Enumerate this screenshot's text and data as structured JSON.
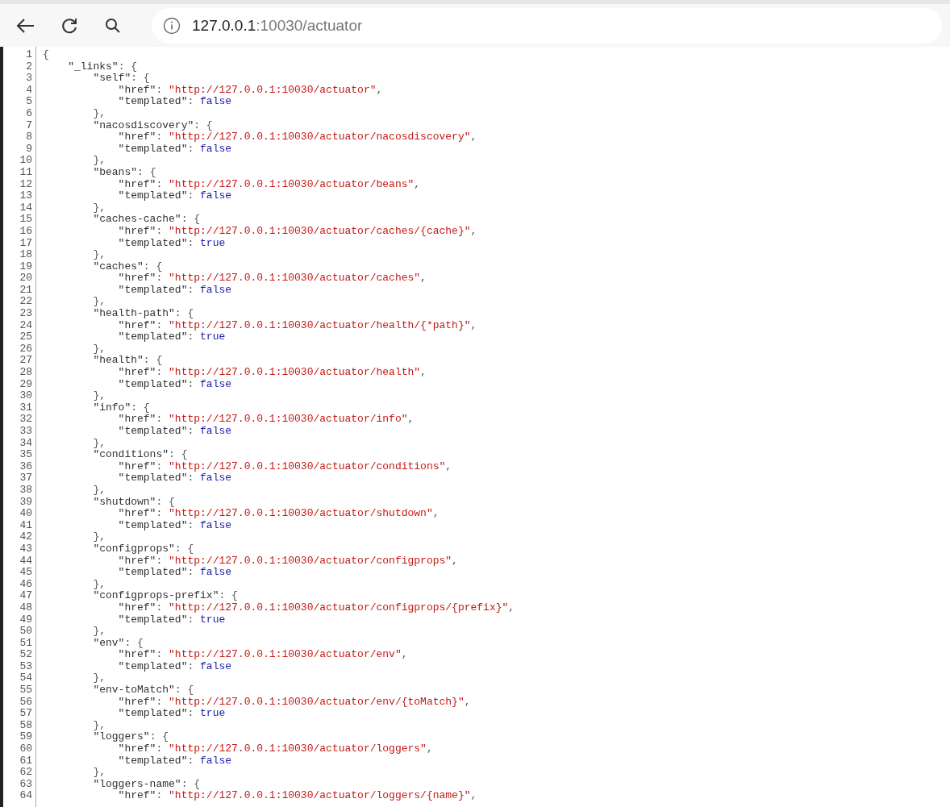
{
  "toolbar": {
    "address": {
      "host": "127.0.0.1",
      "rest": ":10030/actuator"
    }
  },
  "lines": [
    {
      "number": "1",
      "tokens": [
        {
          "kind": "punct",
          "text": "{"
        }
      ]
    },
    {
      "number": "2",
      "tokens": [
        {
          "kind": "key",
          "text": "    \"_links\""
        },
        {
          "kind": "punct",
          "text": ": {"
        }
      ]
    },
    {
      "number": "3",
      "tokens": [
        {
          "kind": "key",
          "text": "        \"self\""
        },
        {
          "kind": "punct",
          "text": ": {"
        }
      ]
    },
    {
      "number": "4",
      "tokens": [
        {
          "kind": "key",
          "text": "            \"href\""
        },
        {
          "kind": "punct",
          "text": ": "
        },
        {
          "kind": "string",
          "text": "\"http://127.0.0.1:10030/actuator\""
        },
        {
          "kind": "punct",
          "text": ","
        }
      ]
    },
    {
      "number": "5",
      "tokens": [
        {
          "kind": "key",
          "text": "            \"templated\""
        },
        {
          "kind": "punct",
          "text": ": "
        },
        {
          "kind": "bool",
          "text": "false"
        }
      ]
    },
    {
      "number": "6",
      "tokens": [
        {
          "kind": "punct",
          "text": "        },"
        }
      ]
    },
    {
      "number": "7",
      "tokens": [
        {
          "kind": "key",
          "text": "        \"nacosdiscovery\""
        },
        {
          "kind": "punct",
          "text": ": {"
        }
      ]
    },
    {
      "number": "8",
      "tokens": [
        {
          "kind": "key",
          "text": "            \"href\""
        },
        {
          "kind": "punct",
          "text": ": "
        },
        {
          "kind": "string",
          "text": "\"http://127.0.0.1:10030/actuator/nacosdiscovery\""
        },
        {
          "kind": "punct",
          "text": ","
        }
      ]
    },
    {
      "number": "9",
      "tokens": [
        {
          "kind": "key",
          "text": "            \"templated\""
        },
        {
          "kind": "punct",
          "text": ": "
        },
        {
          "kind": "bool",
          "text": "false"
        }
      ]
    },
    {
      "number": "10",
      "tokens": [
        {
          "kind": "punct",
          "text": "        },"
        }
      ]
    },
    {
      "number": "11",
      "tokens": [
        {
          "kind": "key",
          "text": "        \"beans\""
        },
        {
          "kind": "punct",
          "text": ": {"
        }
      ]
    },
    {
      "number": "12",
      "tokens": [
        {
          "kind": "key",
          "text": "            \"href\""
        },
        {
          "kind": "punct",
          "text": ": "
        },
        {
          "kind": "string",
          "text": "\"http://127.0.0.1:10030/actuator/beans\""
        },
        {
          "kind": "punct",
          "text": ","
        }
      ]
    },
    {
      "number": "13",
      "tokens": [
        {
          "kind": "key",
          "text": "            \"templated\""
        },
        {
          "kind": "punct",
          "text": ": "
        },
        {
          "kind": "bool",
          "text": "false"
        }
      ]
    },
    {
      "number": "14",
      "tokens": [
        {
          "kind": "punct",
          "text": "        },"
        }
      ]
    },
    {
      "number": "15",
      "tokens": [
        {
          "kind": "key",
          "text": "        \"caches-cache\""
        },
        {
          "kind": "punct",
          "text": ": {"
        }
      ]
    },
    {
      "number": "16",
      "tokens": [
        {
          "kind": "key",
          "text": "            \"href\""
        },
        {
          "kind": "punct",
          "text": ": "
        },
        {
          "kind": "string",
          "text": "\"http://127.0.0.1:10030/actuator/caches/{cache}\""
        },
        {
          "kind": "punct",
          "text": ","
        }
      ]
    },
    {
      "number": "17",
      "tokens": [
        {
          "kind": "key",
          "text": "            \"templated\""
        },
        {
          "kind": "punct",
          "text": ": "
        },
        {
          "kind": "bool",
          "text": "true"
        }
      ]
    },
    {
      "number": "18",
      "tokens": [
        {
          "kind": "punct",
          "text": "        },"
        }
      ]
    },
    {
      "number": "19",
      "tokens": [
        {
          "kind": "key",
          "text": "        \"caches\""
        },
        {
          "kind": "punct",
          "text": ": {"
        }
      ]
    },
    {
      "number": "20",
      "tokens": [
        {
          "kind": "key",
          "text": "            \"href\""
        },
        {
          "kind": "punct",
          "text": ": "
        },
        {
          "kind": "string",
          "text": "\"http://127.0.0.1:10030/actuator/caches\""
        },
        {
          "kind": "punct",
          "text": ","
        }
      ]
    },
    {
      "number": "21",
      "tokens": [
        {
          "kind": "key",
          "text": "            \"templated\""
        },
        {
          "kind": "punct",
          "text": ": "
        },
        {
          "kind": "bool",
          "text": "false"
        }
      ]
    },
    {
      "number": "22",
      "tokens": [
        {
          "kind": "punct",
          "text": "        },"
        }
      ]
    },
    {
      "number": "23",
      "tokens": [
        {
          "kind": "key",
          "text": "        \"health-path\""
        },
        {
          "kind": "punct",
          "text": ": {"
        }
      ]
    },
    {
      "number": "24",
      "tokens": [
        {
          "kind": "key",
          "text": "            \"href\""
        },
        {
          "kind": "punct",
          "text": ": "
        },
        {
          "kind": "string",
          "text": "\"http://127.0.0.1:10030/actuator/health/{*path}\""
        },
        {
          "kind": "punct",
          "text": ","
        }
      ]
    },
    {
      "number": "25",
      "tokens": [
        {
          "kind": "key",
          "text": "            \"templated\""
        },
        {
          "kind": "punct",
          "text": ": "
        },
        {
          "kind": "bool",
          "text": "true"
        }
      ]
    },
    {
      "number": "26",
      "tokens": [
        {
          "kind": "punct",
          "text": "        },"
        }
      ]
    },
    {
      "number": "27",
      "tokens": [
        {
          "kind": "key",
          "text": "        \"health\""
        },
        {
          "kind": "punct",
          "text": ": {"
        }
      ]
    },
    {
      "number": "28",
      "tokens": [
        {
          "kind": "key",
          "text": "            \"href\""
        },
        {
          "kind": "punct",
          "text": ": "
        },
        {
          "kind": "string",
          "text": "\"http://127.0.0.1:10030/actuator/health\""
        },
        {
          "kind": "punct",
          "text": ","
        }
      ]
    },
    {
      "number": "29",
      "tokens": [
        {
          "kind": "key",
          "text": "            \"templated\""
        },
        {
          "kind": "punct",
          "text": ": "
        },
        {
          "kind": "bool",
          "text": "false"
        }
      ]
    },
    {
      "number": "30",
      "tokens": [
        {
          "kind": "punct",
          "text": "        },"
        }
      ]
    },
    {
      "number": "31",
      "tokens": [
        {
          "kind": "key",
          "text": "        \"info\""
        },
        {
          "kind": "punct",
          "text": ": {"
        }
      ]
    },
    {
      "number": "32",
      "tokens": [
        {
          "kind": "key",
          "text": "            \"href\""
        },
        {
          "kind": "punct",
          "text": ": "
        },
        {
          "kind": "string",
          "text": "\"http://127.0.0.1:10030/actuator/info\""
        },
        {
          "kind": "punct",
          "text": ","
        }
      ]
    },
    {
      "number": "33",
      "tokens": [
        {
          "kind": "key",
          "text": "            \"templated\""
        },
        {
          "kind": "punct",
          "text": ": "
        },
        {
          "kind": "bool",
          "text": "false"
        }
      ]
    },
    {
      "number": "34",
      "tokens": [
        {
          "kind": "punct",
          "text": "        },"
        }
      ]
    },
    {
      "number": "35",
      "tokens": [
        {
          "kind": "key",
          "text": "        \"conditions\""
        },
        {
          "kind": "punct",
          "text": ": {"
        }
      ]
    },
    {
      "number": "36",
      "tokens": [
        {
          "kind": "key",
          "text": "            \"href\""
        },
        {
          "kind": "punct",
          "text": ": "
        },
        {
          "kind": "string",
          "text": "\"http://127.0.0.1:10030/actuator/conditions\""
        },
        {
          "kind": "punct",
          "text": ","
        }
      ]
    },
    {
      "number": "37",
      "tokens": [
        {
          "kind": "key",
          "text": "            \"templated\""
        },
        {
          "kind": "punct",
          "text": ": "
        },
        {
          "kind": "bool",
          "text": "false"
        }
      ]
    },
    {
      "number": "38",
      "tokens": [
        {
          "kind": "punct",
          "text": "        },"
        }
      ]
    },
    {
      "number": "39",
      "tokens": [
        {
          "kind": "key",
          "text": "        \"shutdown\""
        },
        {
          "kind": "punct",
          "text": ": {"
        }
      ]
    },
    {
      "number": "40",
      "tokens": [
        {
          "kind": "key",
          "text": "            \"href\""
        },
        {
          "kind": "punct",
          "text": ": "
        },
        {
          "kind": "string",
          "text": "\"http://127.0.0.1:10030/actuator/shutdown\""
        },
        {
          "kind": "punct",
          "text": ","
        }
      ]
    },
    {
      "number": "41",
      "tokens": [
        {
          "kind": "key",
          "text": "            \"templated\""
        },
        {
          "kind": "punct",
          "text": ": "
        },
        {
          "kind": "bool",
          "text": "false"
        }
      ]
    },
    {
      "number": "42",
      "tokens": [
        {
          "kind": "punct",
          "text": "        },"
        }
      ]
    },
    {
      "number": "43",
      "tokens": [
        {
          "kind": "key",
          "text": "        \"configprops\""
        },
        {
          "kind": "punct",
          "text": ": {"
        }
      ]
    },
    {
      "number": "44",
      "tokens": [
        {
          "kind": "key",
          "text": "            \"href\""
        },
        {
          "kind": "punct",
          "text": ": "
        },
        {
          "kind": "string",
          "text": "\"http://127.0.0.1:10030/actuator/configprops\""
        },
        {
          "kind": "punct",
          "text": ","
        }
      ]
    },
    {
      "number": "45",
      "tokens": [
        {
          "kind": "key",
          "text": "            \"templated\""
        },
        {
          "kind": "punct",
          "text": ": "
        },
        {
          "kind": "bool",
          "text": "false"
        }
      ]
    },
    {
      "number": "46",
      "tokens": [
        {
          "kind": "punct",
          "text": "        },"
        }
      ]
    },
    {
      "number": "47",
      "tokens": [
        {
          "kind": "key",
          "text": "        \"configprops-prefix\""
        },
        {
          "kind": "punct",
          "text": ": {"
        }
      ]
    },
    {
      "number": "48",
      "tokens": [
        {
          "kind": "key",
          "text": "            \"href\""
        },
        {
          "kind": "punct",
          "text": ": "
        },
        {
          "kind": "string",
          "text": "\"http://127.0.0.1:10030/actuator/configprops/{prefix}\""
        },
        {
          "kind": "punct",
          "text": ","
        }
      ]
    },
    {
      "number": "49",
      "tokens": [
        {
          "kind": "key",
          "text": "            \"templated\""
        },
        {
          "kind": "punct",
          "text": ": "
        },
        {
          "kind": "bool",
          "text": "true"
        }
      ]
    },
    {
      "number": "50",
      "tokens": [
        {
          "kind": "punct",
          "text": "        },"
        }
      ]
    },
    {
      "number": "51",
      "tokens": [
        {
          "kind": "key",
          "text": "        \"env\""
        },
        {
          "kind": "punct",
          "text": ": {"
        }
      ]
    },
    {
      "number": "52",
      "tokens": [
        {
          "kind": "key",
          "text": "            \"href\""
        },
        {
          "kind": "punct",
          "text": ": "
        },
        {
          "kind": "string",
          "text": "\"http://127.0.0.1:10030/actuator/env\""
        },
        {
          "kind": "punct",
          "text": ","
        }
      ]
    },
    {
      "number": "53",
      "tokens": [
        {
          "kind": "key",
          "text": "            \"templated\""
        },
        {
          "kind": "punct",
          "text": ": "
        },
        {
          "kind": "bool",
          "text": "false"
        }
      ]
    },
    {
      "number": "54",
      "tokens": [
        {
          "kind": "punct",
          "text": "        },"
        }
      ]
    },
    {
      "number": "55",
      "tokens": [
        {
          "kind": "key",
          "text": "        \"env-toMatch\""
        },
        {
          "kind": "punct",
          "text": ": {"
        }
      ]
    },
    {
      "number": "56",
      "tokens": [
        {
          "kind": "key",
          "text": "            \"href\""
        },
        {
          "kind": "punct",
          "text": ": "
        },
        {
          "kind": "string",
          "text": "\"http://127.0.0.1:10030/actuator/env/{toMatch}\""
        },
        {
          "kind": "punct",
          "text": ","
        }
      ]
    },
    {
      "number": "57",
      "tokens": [
        {
          "kind": "key",
          "text": "            \"templated\""
        },
        {
          "kind": "punct",
          "text": ": "
        },
        {
          "kind": "bool",
          "text": "true"
        }
      ]
    },
    {
      "number": "58",
      "tokens": [
        {
          "kind": "punct",
          "text": "        },"
        }
      ]
    },
    {
      "number": "59",
      "tokens": [
        {
          "kind": "key",
          "text": "        \"loggers\""
        },
        {
          "kind": "punct",
          "text": ": {"
        }
      ]
    },
    {
      "number": "60",
      "tokens": [
        {
          "kind": "key",
          "text": "            \"href\""
        },
        {
          "kind": "punct",
          "text": ": "
        },
        {
          "kind": "string",
          "text": "\"http://127.0.0.1:10030/actuator/loggers\""
        },
        {
          "kind": "punct",
          "text": ","
        }
      ]
    },
    {
      "number": "61",
      "tokens": [
        {
          "kind": "key",
          "text": "            \"templated\""
        },
        {
          "kind": "punct",
          "text": ": "
        },
        {
          "kind": "bool",
          "text": "false"
        }
      ]
    },
    {
      "number": "62",
      "tokens": [
        {
          "kind": "punct",
          "text": "        },"
        }
      ]
    },
    {
      "number": "63",
      "tokens": [
        {
          "kind": "key",
          "text": "        \"loggers-name\""
        },
        {
          "kind": "punct",
          "text": ": {"
        }
      ]
    },
    {
      "number": "64",
      "tokens": [
        {
          "kind": "key",
          "text": "            \"href\""
        },
        {
          "kind": "punct",
          "text": ": "
        },
        {
          "kind": "string",
          "text": "\"http://127.0.0.1:10030/actuator/loggers/{name}\""
        },
        {
          "kind": "punct",
          "text": ","
        }
      ]
    }
  ]
}
